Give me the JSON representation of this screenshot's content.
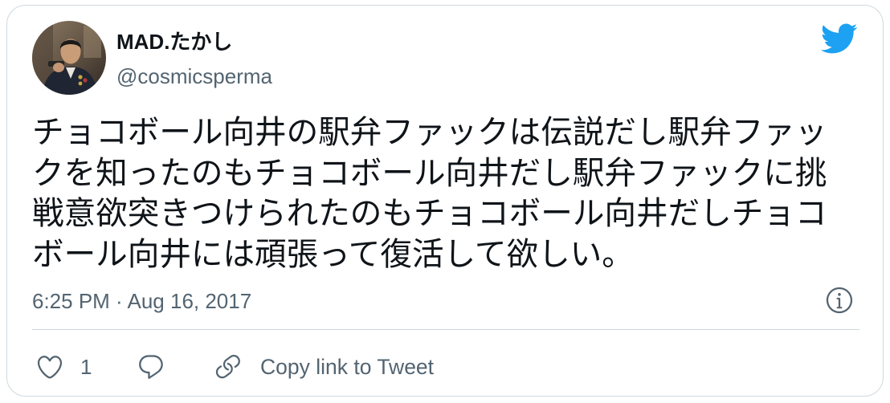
{
  "user": {
    "name": "MAD.たかし",
    "handle": "@cosmicsperma"
  },
  "tweet": {
    "text": "チョコボール向井の駅弁ファックは伝説だし駅弁ファックを知ったのもチョコボール向井だし駅弁ファックに挑戦意欲突きつけられたのもチョコボール向井だしチョコボール向井には頑張って復活して欲しい。",
    "timestamp": "6:25 PM · Aug 16, 2017"
  },
  "actions": {
    "like_count": "1",
    "copy_link_label": "Copy link to Tweet"
  },
  "icons": {
    "brand": "twitter-bird-icon",
    "info": "info-icon",
    "like": "heart-icon",
    "reply": "reply-icon",
    "copy_link": "link-icon"
  },
  "colors": {
    "brand": "#1DA1F2",
    "primary_text": "#0F1419",
    "secondary_text": "#536471",
    "border": "#CFD9DE",
    "background": "#FFFFFF"
  }
}
